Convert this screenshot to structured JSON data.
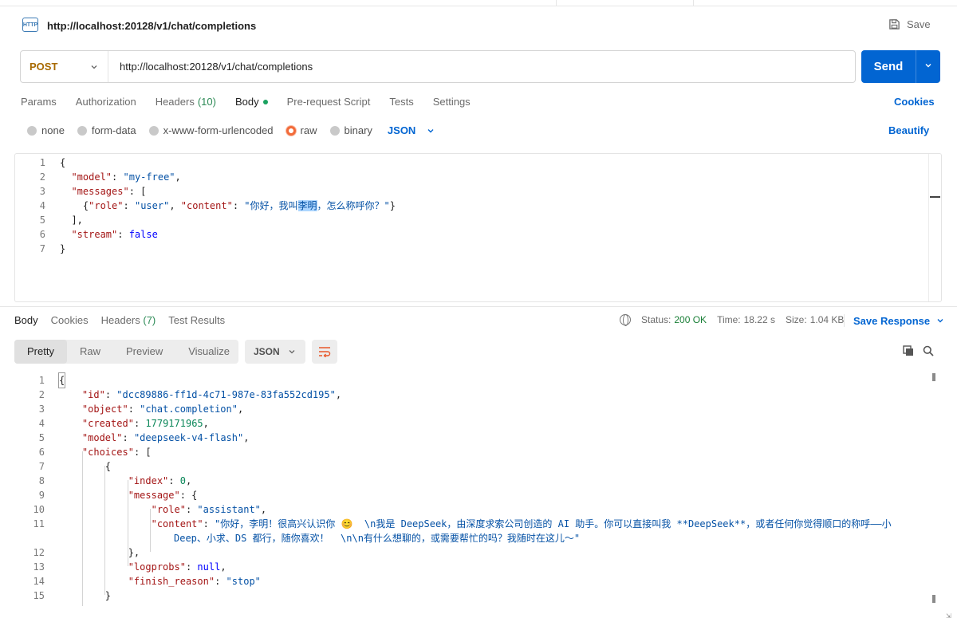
{
  "request": {
    "title": "http://localhost:20128/v1/chat/completions",
    "save_label": "Save",
    "method": "POST",
    "url": "http://localhost:20128/v1/chat/completions",
    "send_label": "Send",
    "tabs": [
      {
        "label": "Params"
      },
      {
        "label": "Authorization"
      },
      {
        "label": "Headers",
        "count": "(10)"
      },
      {
        "label": "Body"
      },
      {
        "label": "Pre-request Script"
      },
      {
        "label": "Tests"
      },
      {
        "label": "Settings"
      }
    ],
    "cookies_label": "Cookies",
    "body_types": [
      "none",
      "form-data",
      "x-www-form-urlencoded",
      "raw",
      "binary"
    ],
    "selected_body_type": "raw",
    "format": "JSON",
    "beautify_label": "Beautify",
    "code_lines": [
      "1",
      "2",
      "3",
      "4",
      "5",
      "6",
      "7"
    ],
    "body": {
      "model": "my-free",
      "role": "user",
      "content_before": "你好，我叫",
      "content_highlight": "李明",
      "content_after": "，怎么称呼你？",
      "stream": "false"
    }
  },
  "response": {
    "tabs": [
      {
        "label": "Body"
      },
      {
        "label": "Cookies"
      },
      {
        "label": "Headers",
        "count": "(7)"
      },
      {
        "label": "Test Results"
      }
    ],
    "status_label": "Status:",
    "status_value": "200 OK",
    "time_label": "Time:",
    "time_value": "18.22 s",
    "size_label": "Size:",
    "size_value": "1.04 KB",
    "save_response_label": "Save Response",
    "views": [
      "Pretty",
      "Raw",
      "Preview",
      "Visualize"
    ],
    "format": "JSON",
    "code_lines": [
      "1",
      "2",
      "3",
      "4",
      "5",
      "6",
      "7",
      "8",
      "9",
      "10",
      "11",
      "12",
      "13",
      "14",
      "15"
    ],
    "json": {
      "id": "dcc89886-ff1d-4c71-987e-83fa552cd195",
      "object": "chat.completion",
      "created": "1779171965",
      "model": "deepseek-v4-flash",
      "index": "0",
      "role": "assistant",
      "content_line1": "\"你好，李明！很高兴认识你 😊  \\n我是 DeepSeek，由深度求索公司创造的 AI 助手。你可以直接叫我 **DeepSeek**，或者任何你觉得顺口的称呼——小",
      "content_line2": "Deep、小求、DS 都行，随你喜欢！  \\n\\n有什么想聊的，或需要帮忙的吗？我随时在这儿～\"",
      "logprobs": "null",
      "finish_reason": "stop"
    }
  },
  "colors": {
    "accent": "#0265d2",
    "method": "#a86a00",
    "status_ok": "#1a7f37",
    "radio_on": "#f26b3a"
  }
}
